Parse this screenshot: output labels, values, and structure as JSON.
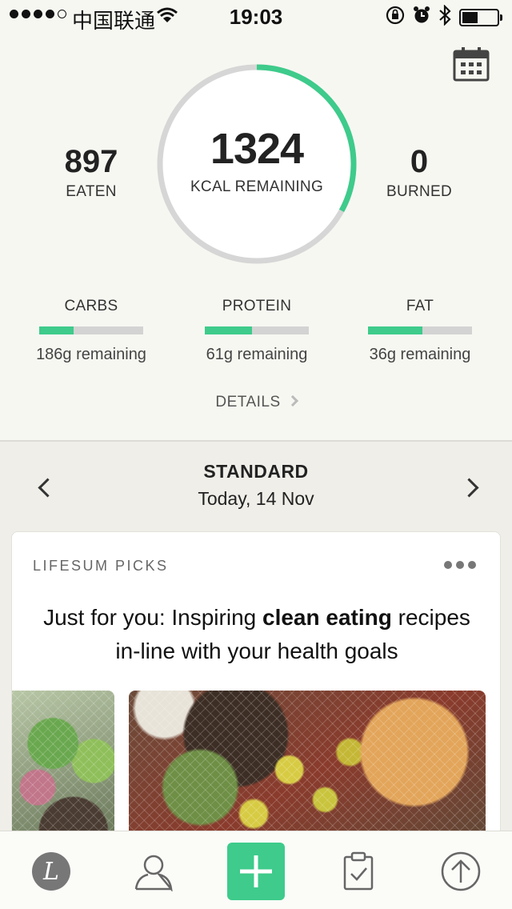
{
  "status_bar": {
    "carrier": "中国联通",
    "time": "19:03",
    "battery_level": 0.45
  },
  "summary": {
    "eaten_value": "897",
    "eaten_label": "EATEN",
    "remaining_value": "1324",
    "remaining_label": "KCAL REMAINING",
    "burned_value": "0",
    "burned_label": "BURNED",
    "progress_fraction": 0.33,
    "accent_color": "#3ecb8b",
    "macros": [
      {
        "name": "CARBS",
        "remaining": "186g remaining",
        "progress": 0.33
      },
      {
        "name": "PROTEIN",
        "remaining": "61g remaining",
        "progress": 0.45
      },
      {
        "name": "FAT",
        "remaining": "36g remaining",
        "progress": 0.52
      }
    ],
    "details_label": "DETAILS"
  },
  "diary": {
    "diet_name": "STANDARD",
    "date": "Today, 14 Nov"
  },
  "card": {
    "label": "LIFESUM PICKS",
    "headline_pre": "Just for you: Inspiring ",
    "headline_bold": "clean eating",
    "headline_post": " recipes in-line with your health goals"
  },
  "tabbar": {
    "home_glyph": "L",
    "icons": [
      "home-icon",
      "profile-icon",
      "add-icon",
      "clipboard-check-icon",
      "upload-icon"
    ]
  }
}
